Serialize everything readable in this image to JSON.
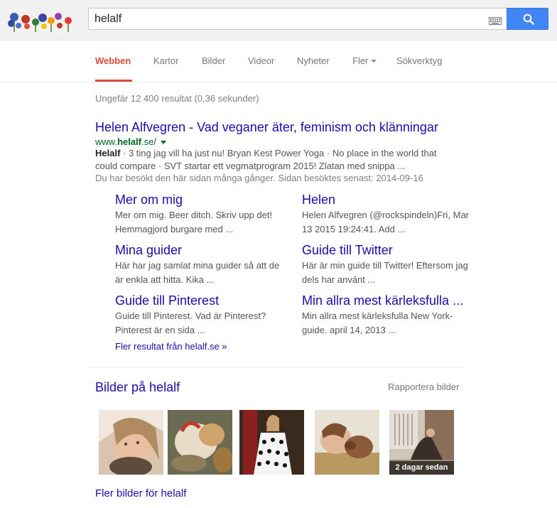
{
  "search": {
    "query": "helalf"
  },
  "tabs": [
    {
      "label": "Webben"
    },
    {
      "label": "Kartor"
    },
    {
      "label": "Bilder"
    },
    {
      "label": "Videor"
    },
    {
      "label": "Nyheter"
    },
    {
      "label": "Fler"
    },
    {
      "label": "Sökverktyg"
    }
  ],
  "stats": "Ungefär 12 400 resultat (0,36 sekunder)",
  "result": {
    "title": "Helen Alfvegren - Vad veganer äter, feminism och klänningar",
    "url_prefix": "www.",
    "url_bold": "helalf",
    "url_suffix": ".se/",
    "snippet_bold": "Helalf",
    "snippet_text": " · 3 ting jag vill ha just nu! Bryan Kest Power Yoga · No place in the world that could compare · SVT startar ett vegmatprogram 2015! Zlatan med snippa ...",
    "visited": "Du har besökt den här sidan många gånger. Sidan besöktes senast: 2014-09-16"
  },
  "sitelinks": [
    {
      "title": "Mer om mig",
      "snippet": "Mer om mig. Beer ditch. Skriv upp det! Hemmagjord burgare med ..."
    },
    {
      "title": "Helen",
      "snippet": "Helen Alfvegren (@rockspindeln)Fri, Mar 13 2015 19:24:41. Add ..."
    },
    {
      "title": "Mina guider",
      "snippet": "Här har jag samlat mina guider så att de är enkla att hitta. Kika ..."
    },
    {
      "title": "Guide till Twitter",
      "snippet": "Här är min guide till Twitter! Eftersom jag dels har använt ..."
    },
    {
      "title": "Guide till Pinterest",
      "snippet": "Guide till Pinterest. Vad är Pinterest? Pinterest är en sida ..."
    },
    {
      "title": "Min allra mest kärleksfulla ...",
      "snippet": "Min allra mest kärleksfulla New York-guide. april 14, 2013 ..."
    }
  ],
  "more_results": "Fler resultat från helalf.se »",
  "images": {
    "heading": "Bilder på helalf",
    "report": "Rapportera bilder",
    "badge": "2 dagar sedan",
    "more": "Fler bilder för helalf"
  },
  "colors": {
    "link": "#1a0dab",
    "url_green": "#006621",
    "active_tab": "#dd4b39",
    "search_button": "#4285f4"
  }
}
